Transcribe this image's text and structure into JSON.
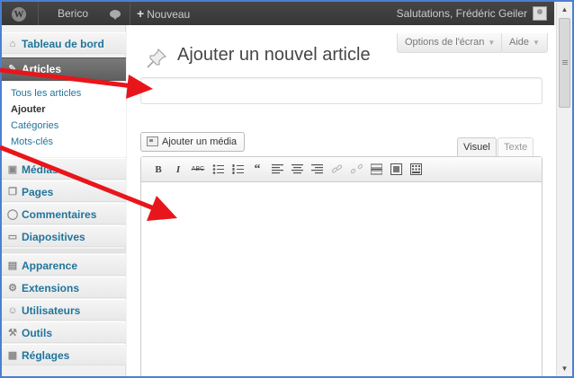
{
  "adminbar": {
    "site_name": "Berico",
    "new_label": "Nouveau",
    "howdy": "Salutations, Frédéric Geiler"
  },
  "menu": {
    "dashboard": "Tableau de bord",
    "articles": "Articles",
    "submenu": [
      "Tous les articles",
      "Ajouter",
      "Catégories",
      "Mots-clés"
    ],
    "medias": "Médias",
    "pages": "Pages",
    "comments": "Commentaires",
    "slides": "Diapositives",
    "appearance": "Apparence",
    "extensions": "Extensions",
    "users": "Utilisateurs",
    "tools": "Outils",
    "settings": "Réglages"
  },
  "header": {
    "screen_options": "Options de l'écran",
    "help": "Aide",
    "page_title": "Ajouter un nouvel article"
  },
  "editor": {
    "title_value": "",
    "add_media": "Ajouter un média",
    "tab_visual": "Visuel",
    "tab_text": "Texte",
    "toolbar": [
      "bold-icon",
      "italic-icon",
      "strikethrough-icon",
      "bullet-list-icon",
      "numbered-list-icon",
      "blockquote-icon",
      "align-left-icon",
      "align-center-icon",
      "align-right-icon",
      "link-icon",
      "unlink-icon",
      "more-tag-icon",
      "fullscreen-icon",
      "kitchen-sink-icon"
    ]
  },
  "colors": {
    "link": "#21759b",
    "adminbar": "#464646",
    "arrow": "#e8151b",
    "window_border": "#4b7fd1"
  }
}
